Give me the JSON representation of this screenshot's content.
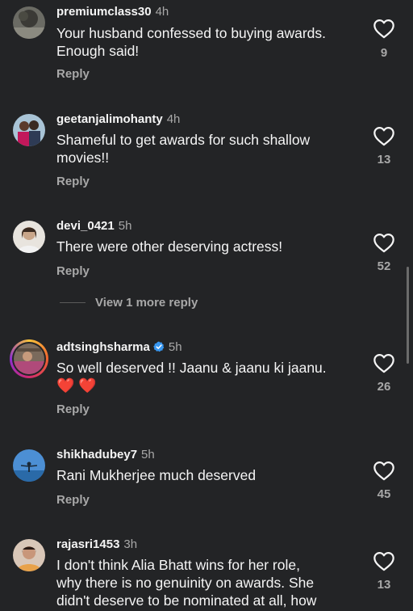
{
  "comments": [
    {
      "username": "premiumclass30",
      "time": "4h",
      "text_lines": [
        "Your husband confessed to buying awards.",
        "Enough said!"
      ],
      "reply": "Reply",
      "likes": "9"
    },
    {
      "username": "geetanjalimohanty",
      "time": "4h",
      "text_lines": [
        "Shameful to get awards for such shallow",
        "movies!!"
      ],
      "reply": "Reply",
      "likes": "13"
    },
    {
      "username": "devi_0421",
      "time": "5h",
      "text_lines": [
        "There were other deserving actress!"
      ],
      "reply": "Reply",
      "likes": "52"
    },
    {
      "username": "adtsinghsharma",
      "time": "5h",
      "text_lines": [
        "So well deserved !! Jaanu & jaanu ki jaanu."
      ],
      "emoji": "❤️ ❤️",
      "reply": "Reply",
      "likes": "26"
    },
    {
      "username": "shikhadubey7",
      "time": "5h",
      "text_lines": [
        "Rani Mukherjee much deserved"
      ],
      "reply": "Reply",
      "likes": "45"
    },
    {
      "username": "rajasri1453",
      "time": "3h",
      "text_lines": [
        "I don't think Alia Bhatt wins for her role,",
        "why there is no genuinity on awards. She",
        "didn't deserve to be nominated at all, how"
      ],
      "likes": "13"
    }
  ],
  "view_more": "View 1 more reply",
  "colors": {
    "background": "#232426",
    "text": "#f5f5f5",
    "muted": "#a8a8a8",
    "verified": "#3897f0"
  }
}
